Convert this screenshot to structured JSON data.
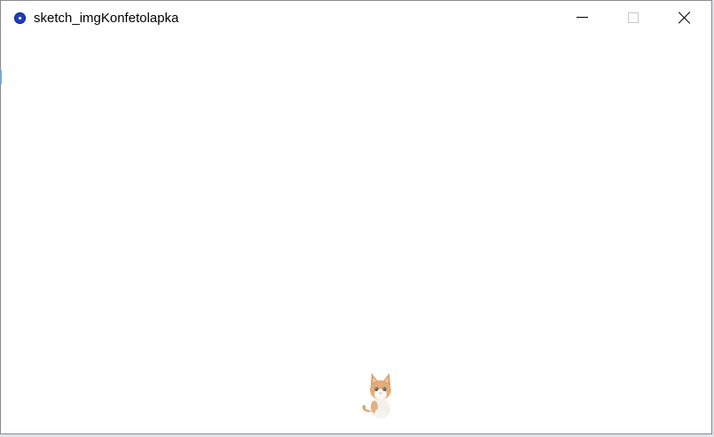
{
  "window": {
    "title": "sketch_imgKonfetolapka",
    "app_icon": "processing-icon",
    "controls": {
      "minimize_icon": "minimize-icon",
      "maximize_icon": "maximize-icon",
      "close_icon": "close-icon"
    }
  },
  "canvas": {
    "background": "#ffffff",
    "sprite": "kitten-sprite"
  }
}
